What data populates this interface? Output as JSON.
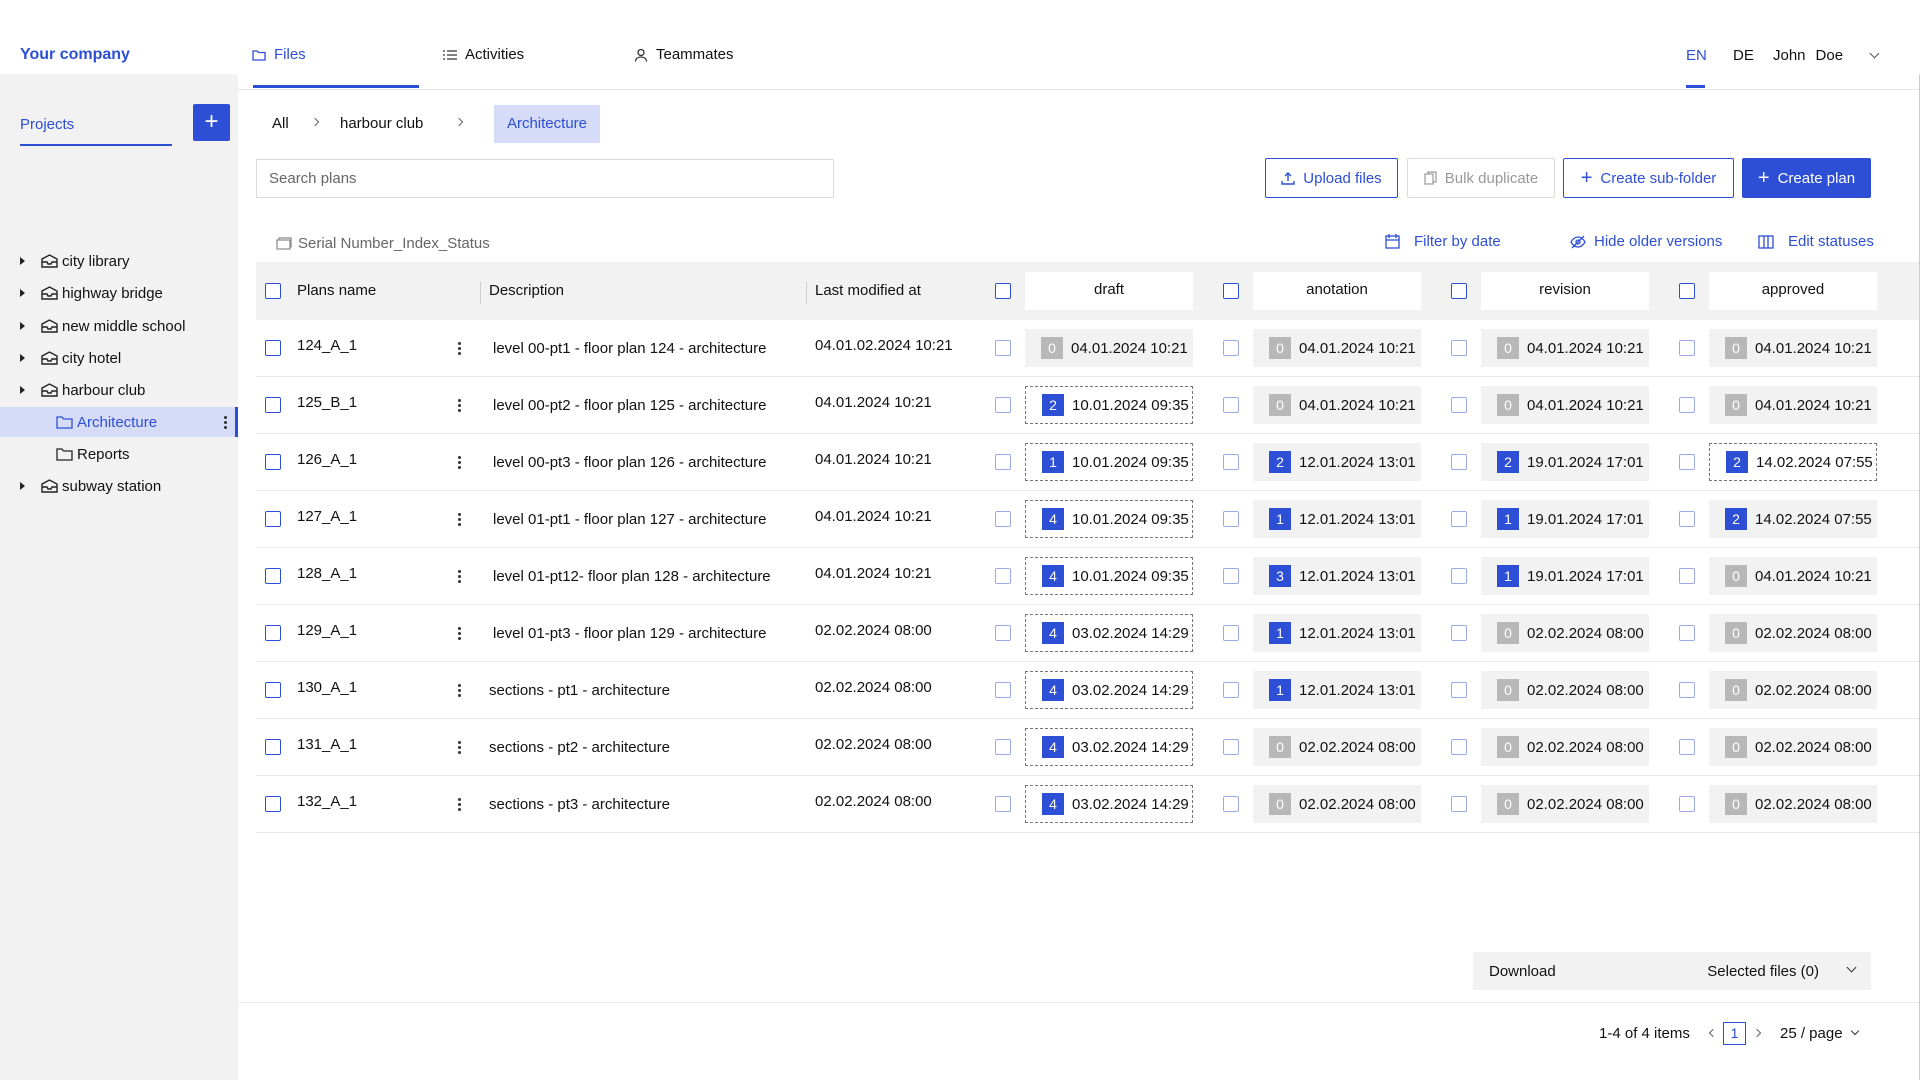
{
  "company": "Your company",
  "tabs": [
    {
      "label": "Files",
      "icon": "folder-icon",
      "active": true
    },
    {
      "label": "Activities",
      "icon": "list-icon",
      "active": false
    },
    {
      "label": "Teammates",
      "icon": "user-icon",
      "active": false
    }
  ],
  "languages": [
    "EN",
    "DE"
  ],
  "active_language": "EN",
  "user": {
    "first": "John",
    "last": "Doe"
  },
  "sidebar": {
    "projects_label": "Projects",
    "add_label": "+",
    "items": [
      {
        "label": "city library",
        "level": 0,
        "icon": "project-icon"
      },
      {
        "label": "highway bridge",
        "level": 0,
        "icon": "project-icon"
      },
      {
        "label": "new middle school",
        "level": 0,
        "icon": "project-icon"
      },
      {
        "label": "city hotel",
        "level": 0,
        "icon": "project-icon"
      },
      {
        "label": "harbour club",
        "level": 0,
        "icon": "project-icon"
      },
      {
        "label": "Architecture",
        "level": 1,
        "icon": "folder-icon",
        "selected": true
      },
      {
        "label": "Reports",
        "level": 1,
        "icon": "folder-icon"
      },
      {
        "label": "subway station",
        "level": 0,
        "icon": "project-icon"
      }
    ]
  },
  "breadcrumb": {
    "items": [
      "All",
      "harbour club"
    ],
    "current": "Architecture"
  },
  "search": {
    "placeholder": "Search plans"
  },
  "buttons": {
    "upload": "Upload files",
    "bulk_duplicate": "Bulk duplicate",
    "create_subfolder": "Create sub-folder",
    "create_plan": "Create plan"
  },
  "toolbar": {
    "serial": "Serial Number_Index_Status",
    "filter_by_date": "Filter by date",
    "hide_older": "Hide older versions",
    "edit_statuses": "Edit statuses"
  },
  "table": {
    "headers": {
      "name": "Plans name",
      "description": "Description",
      "modified": "Last modified at"
    },
    "statuses": [
      "draft",
      "anotation",
      "revision",
      "approved"
    ],
    "rows": [
      {
        "name": "124_A_1",
        "desc": "level 00-pt1 - floor plan 124 - architecture",
        "modified": "04.01.02.2024 10:21",
        "cells": [
          [
            "0",
            "04.01.2024 10:21"
          ],
          [
            "0",
            "04.01.2024 10:21"
          ],
          [
            "0",
            "04.01.2024 10:21"
          ],
          [
            "0",
            "04.01.2024 10:21"
          ]
        ]
      },
      {
        "name": "125_B_1",
        "desc": "level 00-pt2 - floor plan 125 - architecture",
        "modified": "04.01.2024 10:21",
        "cells": [
          [
            "2",
            "10.01.2024 09:35"
          ],
          [
            "0",
            "04.01.2024 10:21"
          ],
          [
            "0",
            "04.01.2024 10:21"
          ],
          [
            "0",
            "04.01.2024 10:21"
          ]
        ]
      },
      {
        "name": "126_A_1",
        "desc": "level 00-pt3 - floor plan 126 - architecture",
        "modified": "04.01.2024 10:21",
        "cells": [
          [
            "1",
            "10.01.2024 09:35"
          ],
          [
            "2",
            "12.01.2024 13:01"
          ],
          [
            "2",
            "19.01.2024 17:01"
          ],
          [
            "2",
            "14.02.2024 07:55"
          ]
        ]
      },
      {
        "name": "127_A_1",
        "desc": "level 01-pt1 - floor plan 127 - architecture",
        "modified": "04.01.2024 10:21",
        "cells": [
          [
            "4",
            "10.01.2024 09:35"
          ],
          [
            "1",
            "12.01.2024 13:01"
          ],
          [
            "1",
            "19.01.2024 17:01"
          ],
          [
            "2",
            "14.02.2024 07:55"
          ]
        ]
      },
      {
        "name": "128_A_1",
        "desc": "level 01-pt12- floor plan 128 - architecture",
        "modified": "04.01.2024 10:21",
        "cells": [
          [
            "4",
            "10.01.2024 09:35"
          ],
          [
            "3",
            "12.01.2024 13:01"
          ],
          [
            "1",
            "19.01.2024 17:01"
          ],
          [
            "0",
            "04.01.2024 10:21"
          ]
        ]
      },
      {
        "name": "129_A_1",
        "desc": "level 01-pt3 - floor plan 129 - architecture",
        "modified": "02.02.2024 08:00",
        "cells": [
          [
            "4",
            "03.02.2024 14:29"
          ],
          [
            "1",
            "12.01.2024 13:01"
          ],
          [
            "0",
            "02.02.2024 08:00"
          ],
          [
            "0",
            "02.02.2024 08:00"
          ]
        ]
      },
      {
        "name": "130_A_1",
        "desc": "sections - pt1 - architecture",
        "modified": "02.02.2024 08:00",
        "cells": [
          [
            "4",
            "03.02.2024 14:29"
          ],
          [
            "1",
            "12.01.2024 13:01"
          ],
          [
            "0",
            "02.02.2024 08:00"
          ],
          [
            "0",
            "02.02.2024 08:00"
          ]
        ]
      },
      {
        "name": "131_A_1",
        "desc": "sections - pt2 - architecture",
        "modified": "02.02.2024 08:00",
        "cells": [
          [
            "4",
            "03.02.2024 14:29"
          ],
          [
            "0",
            "02.02.2024 08:00"
          ],
          [
            "0",
            "02.02.2024 08:00"
          ],
          [
            "0",
            "02.02.2024 08:00"
          ]
        ]
      },
      {
        "name": "132_A_1",
        "desc": "sections - pt3 - architecture",
        "modified": "02.02.2024 08:00",
        "cells": [
          [
            "4",
            "03.02.2024 14:29"
          ],
          [
            "0",
            "02.02.2024 08:00"
          ],
          [
            "0",
            "02.02.2024 08:00"
          ],
          [
            "0",
            "02.02.2024 08:00"
          ]
        ]
      }
    ]
  },
  "download": {
    "label": "Download",
    "selected": "Selected files (0)"
  },
  "pagination": {
    "summary": "1-4 of 4 items",
    "page": "1",
    "per_page": "25 / page"
  },
  "colors": {
    "accent": "#2d4fd6",
    "selected_bg": "#d6dcf7",
    "sidebar_bg": "#f2f2f2",
    "badge_gray": "#b8b8b8"
  }
}
